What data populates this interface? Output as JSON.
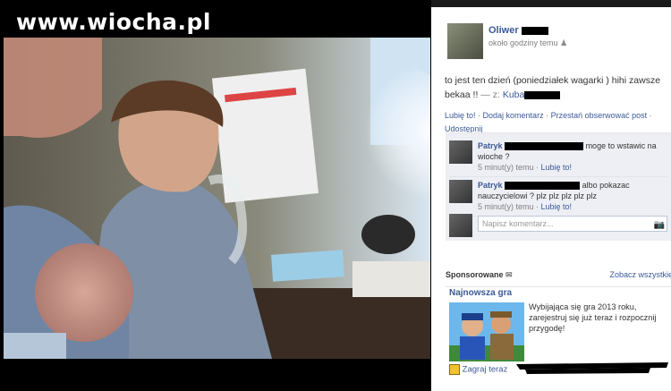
{
  "watermark": "www.wiocha.pl",
  "post": {
    "author": "Oliwer",
    "time": "około godziny temu",
    "text": "to jest ten dzień (poniedziałek wagarki ) hihi zawsze bekaa !!",
    "with_prefix": " — z:",
    "tagged": "Kuba",
    "actions": {
      "like": "Lubię to!",
      "comment": "Dodaj komentarz",
      "unfollow": "Przestań obserwować post",
      "share": "Udostępnij"
    }
  },
  "comments": [
    {
      "name": "Patryk",
      "text": "moge to wstawic na wioche ?",
      "time": "5 minut(y) temu",
      "like": "Lubię to!"
    },
    {
      "name": "Patryk",
      "text": "albo pokazac nauczycielowi ? plz plz plz plz plz",
      "time": "5 minut(y) temu",
      "like": "Lubię to!"
    }
  ],
  "composer": {
    "placeholder": "Napisz komentarz..."
  },
  "sponsored": {
    "title": "Sponsorowane",
    "see_all": "Zobacz wszystkie",
    "ad": {
      "title": "Najnowsza gra",
      "description": "Wybijająca się gra 2013 roku, zarejestruj się już teraz i rozpocznij przygodę!",
      "cta": "Zagraj teraz"
    }
  },
  "colors": {
    "link": "#3b5998",
    "panel_bg": "#edeff4"
  },
  "icons": [
    "people-icon",
    "camera-icon",
    "megaphone-icon",
    "game-icon"
  ]
}
